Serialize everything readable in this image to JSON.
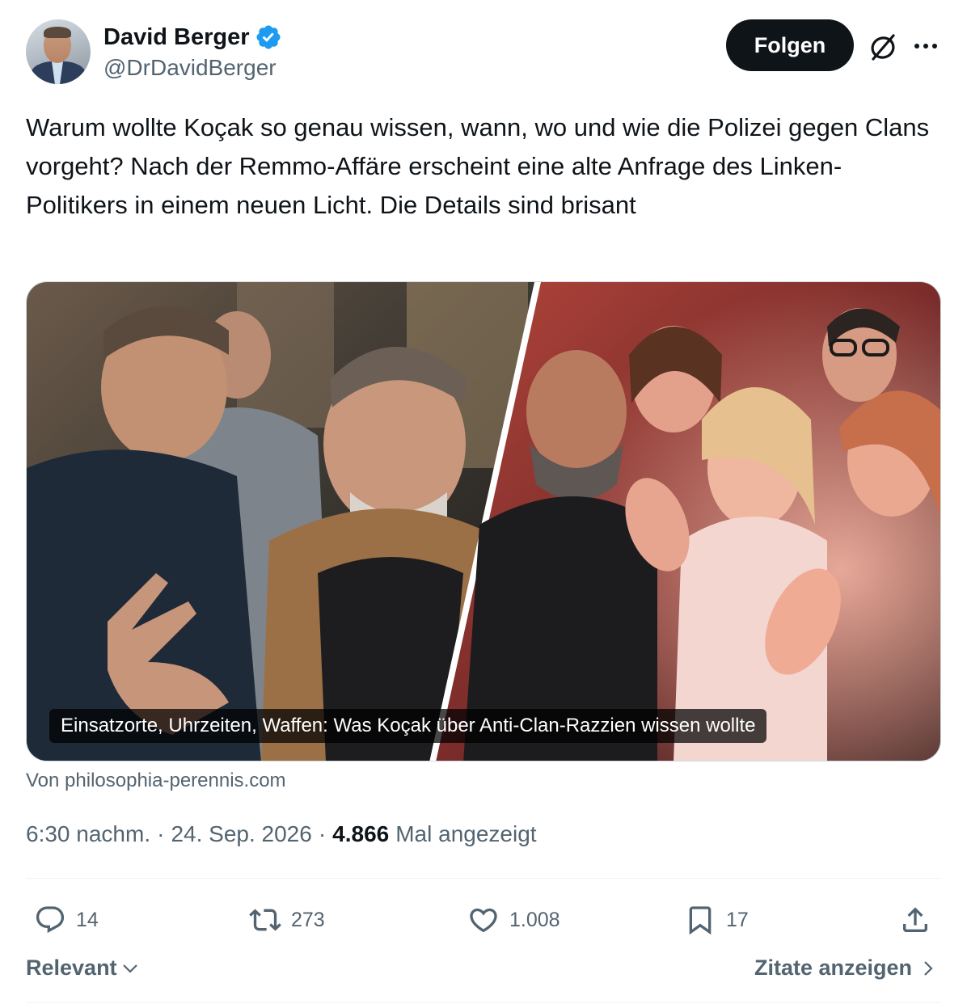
{
  "author": {
    "name": "David Berger",
    "handle": "@DrDavidBerger",
    "verified": true,
    "verified_color": "#1d9bf0"
  },
  "header": {
    "follow_label": "Folgen",
    "grok_icon": "grok-icon",
    "more_icon": "more-icon"
  },
  "tweet": {
    "text": "Warum wollte Koçak so genau wissen, wann, wo und wie die Polizei gegen Clans vorgeht? Nach der Remmo-Affäre erscheint eine alte Anfrage des Linken-Politikers in einem neuen Licht. Die Details sind brisant"
  },
  "card": {
    "caption": "Einsatzorte, Uhrzeiten, Waffen: Was Koçak über Anti-Clan-Razzien wissen wollte",
    "source": "Von philosophia-perennis.com"
  },
  "meta": {
    "time": "6:30 nachm.",
    "separator": "·",
    "date": "24. Sep. 2026",
    "views_count": "4.866",
    "views_label": "Mal angezeigt"
  },
  "actions": {
    "replies": "14",
    "reposts": "273",
    "likes": "1.008",
    "bookmarks": "17"
  },
  "footer": {
    "sort_label": "Relevant",
    "quotes_label": "Zitate anzeigen"
  },
  "colors": {
    "text_primary": "#0f1419",
    "text_secondary": "#536471",
    "button_bg": "#0f1419",
    "divider": "#eff3f4"
  }
}
